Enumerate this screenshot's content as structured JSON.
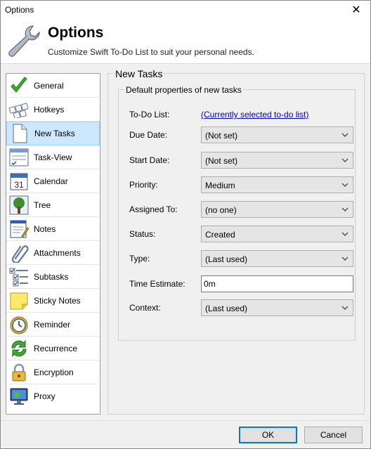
{
  "window": {
    "title": "Options",
    "close_glyph": "✕"
  },
  "header": {
    "title": "Options",
    "subtitle": "Customize Swift To-Do List to suit your personal needs.",
    "icon": "wrench-icon"
  },
  "sidebar": {
    "selected": "New Tasks",
    "items": [
      {
        "label": "General",
        "icon": "checkmark-icon"
      },
      {
        "label": "Hotkeys",
        "icon": "keyboard-icon"
      },
      {
        "label": "New Tasks",
        "icon": "blank-page-icon"
      },
      {
        "label": "Task-View",
        "icon": "task-view-icon"
      },
      {
        "label": "Calendar",
        "icon": "calendar-icon",
        "glyph": "31"
      },
      {
        "label": "Tree",
        "icon": "tree-icon"
      },
      {
        "label": "Notes",
        "icon": "notes-icon"
      },
      {
        "label": "Attachments",
        "icon": "paperclip-icon"
      },
      {
        "label": "Subtasks",
        "icon": "subtasks-icon"
      },
      {
        "label": "Sticky Notes",
        "icon": "sticky-note-icon"
      },
      {
        "label": "Reminder",
        "icon": "alarm-clock-icon"
      },
      {
        "label": "Recurrence",
        "icon": "recurrence-icon"
      },
      {
        "label": "Encryption",
        "icon": "padlock-icon"
      },
      {
        "label": "Proxy",
        "icon": "monitor-icon"
      }
    ]
  },
  "panel": {
    "title": "New Tasks",
    "group_title": "Default properties of new tasks",
    "fields": {
      "todo_list": {
        "label": "To-Do List:",
        "value": "(Currently selected to-do list)"
      },
      "due_date": {
        "label": "Due Date:",
        "value": "(Not set)"
      },
      "start_date": {
        "label": "Start Date:",
        "value": "(Not set)"
      },
      "priority": {
        "label": "Priority:",
        "value": "Medium"
      },
      "assigned_to": {
        "label": "Assigned To:",
        "value": "(no one)"
      },
      "status": {
        "label": "Status:",
        "value": "Created"
      },
      "type": {
        "label": "Type:",
        "value": "(Last used)"
      },
      "time_estimate": {
        "label": "Time Estimate:",
        "value": "0m"
      },
      "context": {
        "label": "Context:",
        "value": "(Last used)"
      }
    }
  },
  "buttons": {
    "ok": "OK",
    "cancel": "Cancel"
  },
  "colors": {
    "selection": "#cce8ff",
    "link": "#0000cc",
    "accent": "#0078d7"
  }
}
